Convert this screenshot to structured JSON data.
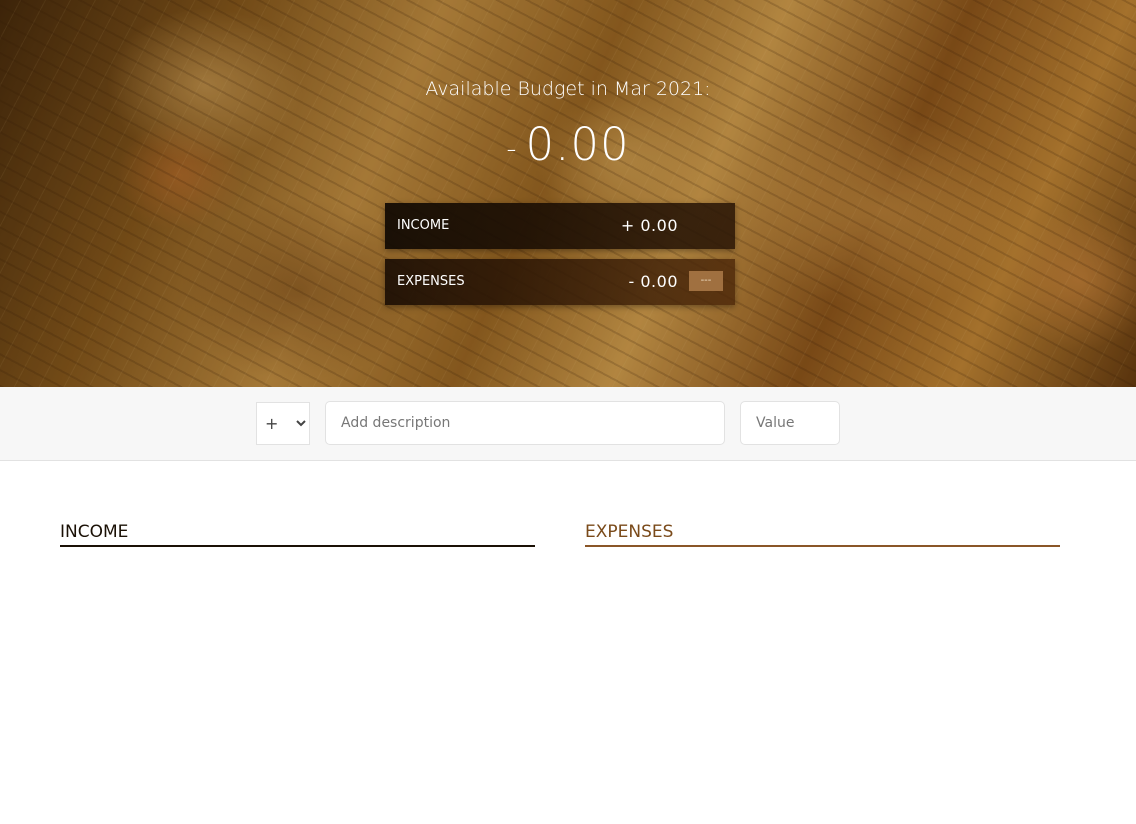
{
  "budget": {
    "title": "Available Budget in Mar 2021:",
    "sign": "-",
    "value": "0.00"
  },
  "summary": {
    "income": {
      "label": "INCOME",
      "value": "+ 0.00"
    },
    "expenses": {
      "label": "EXPENSES",
      "value": "- 0.00",
      "percentage": "---"
    }
  },
  "add_bar": {
    "type_options": [
      "+"
    ],
    "type_selected": "+",
    "description_placeholder": "Add description",
    "value_placeholder": "Value"
  },
  "lists": {
    "income_title": "INCOME",
    "expenses_title": "EXPENSES"
  },
  "colors": {
    "income_accent": "#1a1005",
    "expenses_accent": "#8a5628",
    "percentage_badge": "#a07040"
  }
}
